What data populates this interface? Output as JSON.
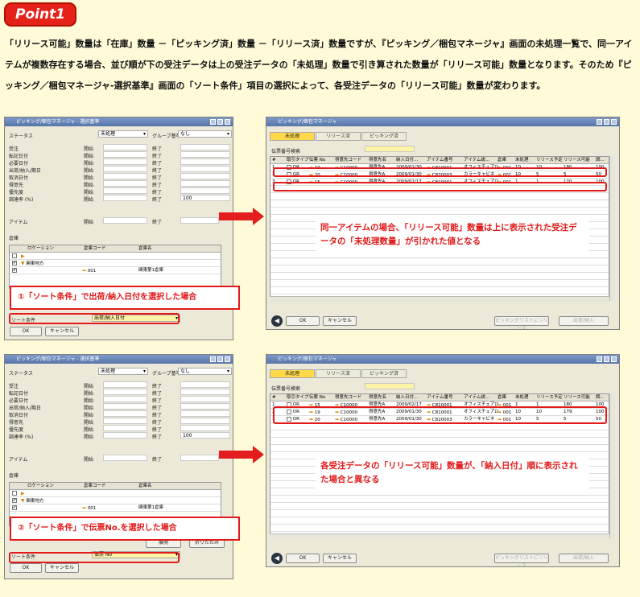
{
  "badge": "Point1",
  "intro": "「リリース可能」数量は「在庫」数量 －「ピッキング済」数量 －「リリース済」数量ですが、『ピッキング／梱包マネージャ』画面の未処理一覧で、同一アイテムが複数存在する場合、並び順が下の受注データは上の受注データの「未処理」数量で引き算された数量が「リリース可能」数量となります。そのため『ピッキング／梱包マネージャ-選択基準』画面の「ソート条件」項目の選択によって、各受注データの「リリース可能」数量が変わります。",
  "criteria_window": {
    "title": "ピッキング/梱包マネージャ - 選択基準",
    "status_label": "ステータス",
    "status_value": "未処理",
    "group_label": "グループ基準",
    "group_value": "なし",
    "rows": [
      {
        "label": "受注",
        "from": "開始",
        "to": "終了"
      },
      {
        "label": "転記日付",
        "from": "開始",
        "to": "終了"
      },
      {
        "label": "必要日付",
        "from": "開始",
        "to": "終了"
      },
      {
        "label": "出荷/納入/期日",
        "from": "開始",
        "to": "終了"
      },
      {
        "label": "取消日付",
        "from": "開始",
        "to": "終了"
      },
      {
        "label": "得意先",
        "from": "開始",
        "to": "終了"
      },
      {
        "label": "優先度",
        "from": "開始",
        "to": "終了"
      },
      {
        "label": "調達率 (%)",
        "from": "開始",
        "to": "終了",
        "to_value": "100"
      }
    ],
    "item_label": "アイテム",
    "item_from": "開始",
    "item_to": "終了",
    "wh_section": "倉庫",
    "wh_headers": [
      "ロケーション",
      "倉庫コード",
      "倉庫名"
    ],
    "wh_rows": [
      {
        "loc": "",
        "code": "",
        "name": ""
      },
      {
        "loc": "関東地方",
        "code": "",
        "name": ""
      },
      {
        "loc": "",
        "code": "001",
        "name": "関東第1倉庫"
      }
    ],
    "expand_btn": "展開",
    "collapse_btn": "折りたたみ",
    "sort_label": "ソート条件",
    "ok": "OK",
    "cancel": "キャンセル"
  },
  "sort_values": [
    "出荷/納入日付",
    "伝票 No"
  ],
  "callouts": [
    "①「ソート条件」で出荷/納入日付を選択した場合",
    "②「ソート条件」で伝票No.を選択した場合"
  ],
  "manager_window": {
    "title": "ピッキング/梱包マネージャ",
    "tabs": [
      "未処理",
      "リリース済",
      "ピッキング済"
    ],
    "search_label": "伝票番号検索",
    "headers": [
      "#",
      "取引タイプ",
      "伝票 No",
      "得意先コード",
      "得意先名",
      "納入日付...",
      "アイテム番号",
      "アイテム説...",
      "倉庫",
      "未処理",
      "リリース予定",
      "リリース可能",
      "調..."
    ],
    "ok": "OK",
    "cancel": "キャンセル",
    "release_btn": "ピッキングリストにリリース",
    "ship_btn": "出荷/納入"
  },
  "table1": [
    {
      "n": "1",
      "type": "OR",
      "doc": "19",
      "cust": "C10000",
      "name": "得意先A",
      "date": "2009/01/30",
      "item": "C810001",
      "desc": "オフィスチェアｴﾙ",
      "wh": "001",
      "open": "10",
      "plan": "10",
      "avail": "180",
      "pct": "100"
    },
    {
      "n": "2",
      "type": "OR",
      "doc": "20",
      "cust": "C10000",
      "name": "得意先A",
      "date": "2009/01/30",
      "item": "C820003",
      "desc": "カラーキャビネ",
      "wh": "001",
      "open": "10",
      "plan": "5",
      "avail": "5",
      "pct": "50"
    },
    {
      "n": "3",
      "type": "OR",
      "doc": "15",
      "cust": "C10000",
      "name": "得意先A",
      "date": "2009/02/17",
      "item": "C810001",
      "desc": "オフィスチェアｴﾙ",
      "wh": "001",
      "open": "1",
      "plan": "1",
      "avail": "170",
      "pct": "100"
    }
  ],
  "table2": [
    {
      "n": "1",
      "type": "OR",
      "doc": "15",
      "cust": "C10000",
      "name": "得意先A",
      "date": "2009/02/17",
      "item": "C810001",
      "desc": "オフィスチェアｴﾙ",
      "wh": "001",
      "open": "1",
      "plan": "1",
      "avail": "180",
      "pct": "100"
    },
    {
      "n": "2",
      "type": "OR",
      "doc": "19",
      "cust": "C10000",
      "name": "得意先A",
      "date": "2009/01/30",
      "item": "C810001",
      "desc": "オフィスチェアｴﾙ",
      "wh": "001",
      "open": "10",
      "plan": "10",
      "avail": "179",
      "pct": "100"
    },
    {
      "n": "3",
      "type": "OR",
      "doc": "20",
      "cust": "C10000",
      "name": "得意先A",
      "date": "2009/01/30",
      "item": "C820003",
      "desc": "カラーキャビネ",
      "wh": "001",
      "open": "10",
      "plan": "5",
      "avail": "5",
      "pct": "50"
    }
  ],
  "notes": [
    "同一アイテムの場合、「リリース可能」数量は上に表示された受注データの「未処理数量」が引かれた値となる",
    "各受注データの「リリース可能」数量が、「納入日付」順に表示された場合と異なる"
  ]
}
